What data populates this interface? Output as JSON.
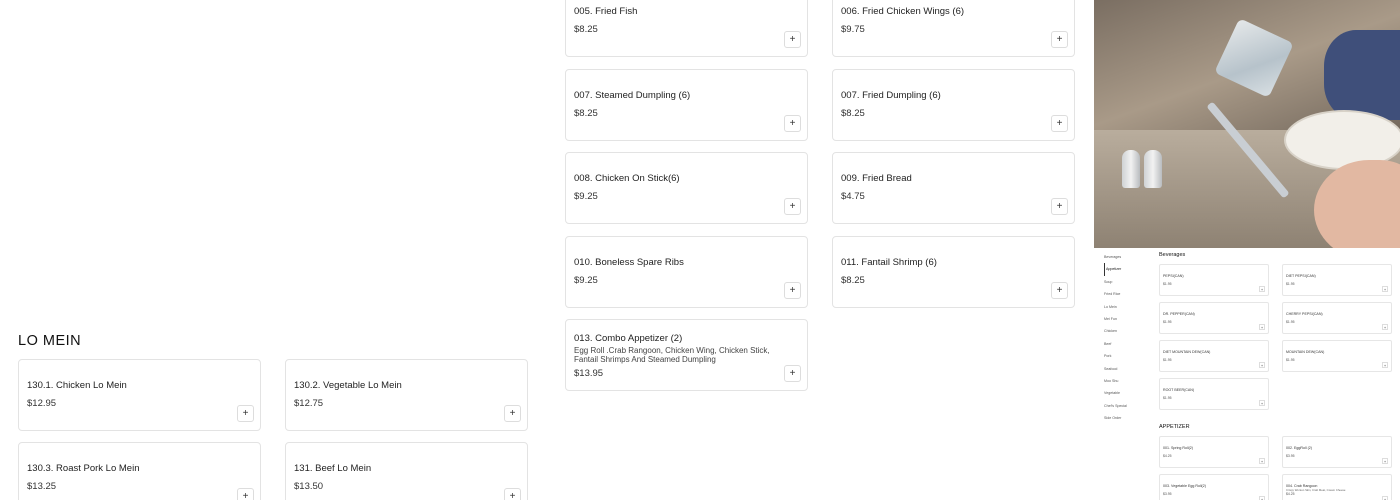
{
  "menu_items": [
    {
      "name": "005. Fried Fish",
      "price": "$8.25"
    },
    {
      "name": "006. Fried Chicken Wings (6)",
      "price": "$9.75"
    },
    {
      "name": "007. Steamed Dumpling (6)",
      "price": "$8.25"
    },
    {
      "name": "007. Fried Dumpling (6)",
      "price": "$8.25"
    },
    {
      "name": "008. Chicken On Stick(6)",
      "price": "$9.25"
    },
    {
      "name": "009. Fried Bread",
      "price": "$4.75"
    },
    {
      "name": "010. Boneless Spare Ribs",
      "price": "$9.25"
    },
    {
      "name": "011. Fantail Shrimp (6)",
      "price": "$8.25"
    },
    {
      "name": "013. Combo Appetizer (2)",
      "description": "Egg Roll .Crab Rangoon, Chicken Wing, Chicken Stick, Fantail Shrimps And Steamed Dumpling",
      "price": "$13.95"
    }
  ],
  "add_symbol": "+",
  "section": {
    "title": "LO MEIN"
  },
  "lo_mein_items": [
    {
      "name": "130.1. Chicken Lo Mein",
      "price": "$12.95"
    },
    {
      "name": "130.2. Vegetable Lo Mein",
      "price": "$12.75"
    },
    {
      "name": "130.3. Roast Pork Lo Mein",
      "price": "$13.25"
    },
    {
      "name": "131. Beef Lo Mein",
      "price": "$13.50"
    }
  ],
  "preview": {
    "nav": [
      "Beverages",
      "Appetizer",
      "Soup",
      "Fried Rice",
      "Lo Mein",
      "Mei Fun",
      "Chicken",
      "Beef",
      "Pork",
      "Seafood",
      "Moo Shu",
      "Vegetable",
      "Chef's Special",
      "Side Order"
    ],
    "active_nav": "Appetizer",
    "beverages_title": "Beverages",
    "beverages": [
      {
        "name": "PEPSI(CAN)",
        "price": "$1.95"
      },
      {
        "name": "DIET PEPSI(CAN)",
        "price": "$1.95"
      },
      {
        "name": "DR. PEPPER(CAN)",
        "price": "$1.95"
      },
      {
        "name": "CHERRY PEPSI(CAN)",
        "price": "$1.95"
      },
      {
        "name": "DIET MOUNTAIN DEW(CAN)",
        "price": "$1.95"
      },
      {
        "name": "MOUNTAIN DEW(CAN)",
        "price": "$1.95"
      },
      {
        "name": "ROOT BEER(CAN)",
        "price": "$1.95"
      }
    ],
    "appetizer_title": "APPETIZER",
    "appetizers": [
      {
        "name": "001. Spring Roll(2)",
        "price": "$4.25"
      },
      {
        "name": "002. EggRoll (2)",
        "price": "$3.95"
      },
      {
        "name": "003. Vegetable Egg Roll(2)",
        "price": "$3.95"
      },
      {
        "name": "004. Crab Rangoon",
        "description": "Crispy Wonton Skin, Crab Meat, Cream Cheese",
        "price": "$4.25"
      }
    ]
  },
  "photo": {
    "alt_subject": "fork-with-ice-photo"
  }
}
